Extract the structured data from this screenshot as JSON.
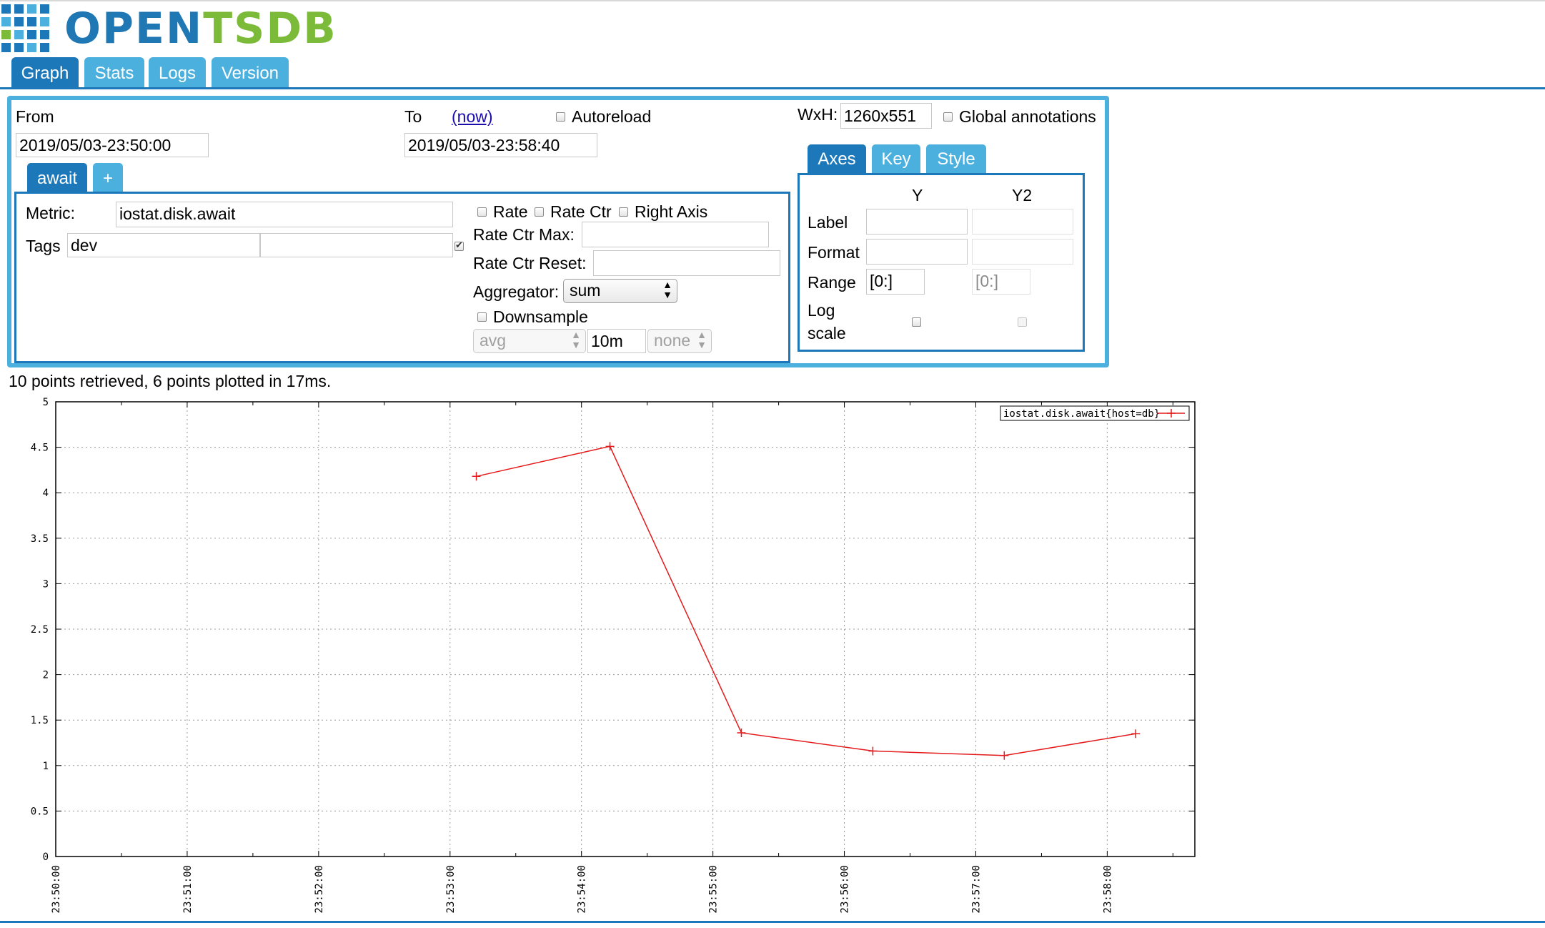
{
  "app": {
    "logo_text_open": "OPEN",
    "logo_text_tsdb": "TSDB",
    "colors": {
      "brand_blue": "#1c78b8",
      "tab_light": "#4bb0de",
      "brand_green": "#7cbb3a",
      "series": "#e41a1c"
    }
  },
  "main_tabs": [
    {
      "label": "Graph",
      "active": true
    },
    {
      "label": "Stats",
      "active": false
    },
    {
      "label": "Logs",
      "active": false
    },
    {
      "label": "Version",
      "active": false
    }
  ],
  "query": {
    "from_label": "From",
    "from_value": "2019/05/03-23:50:00",
    "to_label": "To",
    "now_link": "(now)",
    "to_value": "2019/05/03-23:58:40",
    "autoreload_label": "Autoreload",
    "autoreload_checked": false,
    "wxh_label": "WxH:",
    "wxh_value": "1260x551",
    "global_annotations_label": "Global annotations",
    "global_annotations_checked": false,
    "metric_tabs": [
      {
        "label": "await",
        "active": true
      },
      {
        "label": "+",
        "active": false
      }
    ],
    "metric_label": "Metric:",
    "metric_value": "iostat.disk.await",
    "tags_label": "Tags",
    "tag_key": "dev",
    "tag_value": "",
    "tag_checked": true,
    "rate_label": "Rate",
    "rate_ctr_label": "Rate Ctr",
    "right_axis_label": "Right Axis",
    "rate_ctr_max_label": "Rate Ctr Max:",
    "rate_ctr_reset_label": "Rate Ctr Reset:",
    "aggregator_label": "Aggregator:",
    "aggregator_value": "sum",
    "downsample_label": "Downsample",
    "downsample_agg": "avg",
    "downsample_interval": "10m",
    "downsample_fill": "none"
  },
  "axes_panel": {
    "tabs": [
      {
        "label": "Axes",
        "active": true
      },
      {
        "label": "Key",
        "active": false
      },
      {
        "label": "Style",
        "active": false
      }
    ],
    "y_header": "Y",
    "y2_header": "Y2",
    "label_label": "Label",
    "format_label": "Format",
    "range_label": "Range",
    "y_range": "[0:]",
    "y2_range": "[0:]",
    "log_label_1": "Log",
    "log_label_2": "scale"
  },
  "status_text": "10 points retrieved, 6 points plotted in 17ms.",
  "chart_data": {
    "type": "line",
    "x_tick_labels": [
      "23:50:00",
      "23:51:00",
      "23:52:00",
      "23:53:00",
      "23:54:00",
      "23:55:00",
      "23:56:00",
      "23:57:00",
      "23:58:00"
    ],
    "x_range": [
      "23:50:00",
      "23:58:40"
    ],
    "y_ticks": [
      0,
      0.5,
      1,
      1.5,
      2,
      2.5,
      3,
      3.5,
      4,
      4.5,
      5
    ],
    "ylim": [
      0,
      5
    ],
    "grid": true,
    "legend_position": "top-right",
    "series": [
      {
        "name": "iostat.disk.await{host=db}",
        "color": "#e41a1c",
        "points": [
          {
            "x": "23:53:12",
            "y": 4.18
          },
          {
            "x": "23:54:13",
            "y": 4.51
          },
          {
            "x": "23:55:13",
            "y": 1.36
          },
          {
            "x": "23:56:13",
            "y": 1.16
          },
          {
            "x": "23:57:13",
            "y": 1.11
          },
          {
            "x": "23:58:13",
            "y": 1.35
          }
        ]
      }
    ]
  }
}
